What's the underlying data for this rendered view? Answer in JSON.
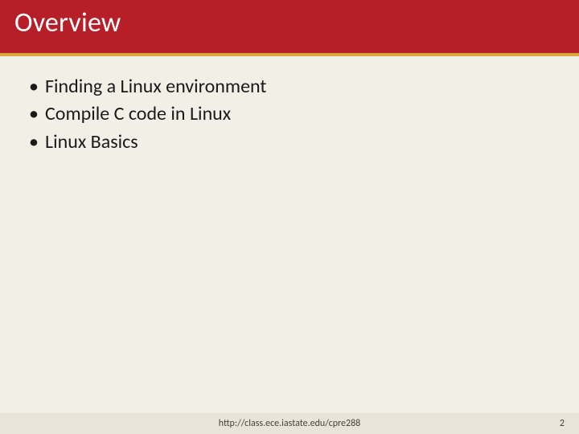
{
  "slide": {
    "title": "Overview",
    "bullets": [
      "Finding a Linux environment",
      "Compile C code in Linux",
      "Linux Basics"
    ]
  },
  "footer": {
    "url": "http://class.ece.iastate.edu/cpre288",
    "page": "2"
  }
}
